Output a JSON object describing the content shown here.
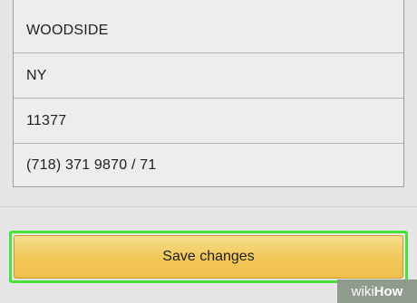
{
  "address_form": {
    "city": "WOODSIDE",
    "state": "NY",
    "zip": "11377",
    "phone": "(718) 371 9870 / 71"
  },
  "actions": {
    "save_label": "Save changes"
  },
  "watermark": {
    "wiki": "wiki",
    "how": "How"
  }
}
